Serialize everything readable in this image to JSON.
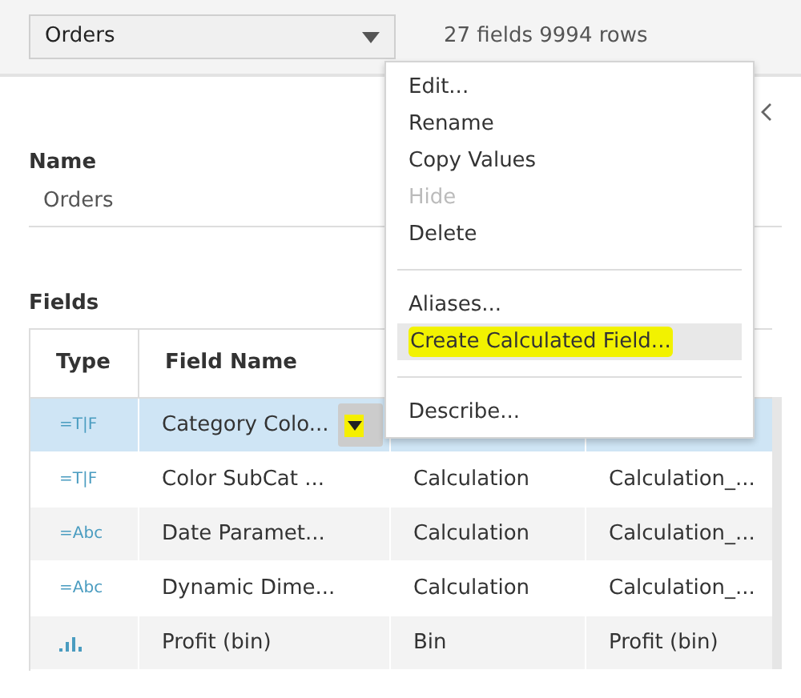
{
  "source_select": {
    "value": "Orders"
  },
  "summary": "27 fields 9994 rows",
  "name_section": {
    "label": "Name",
    "value": "Orders"
  },
  "fields_section": {
    "label": "Fields",
    "columns": [
      "Type",
      "Field Name"
    ],
    "rows": [
      {
        "kind": "boolean",
        "type_icon": "=T|F",
        "name": "Category Colo...",
        "selected": true
      },
      {
        "kind": "boolean",
        "type_icon": "=T|F",
        "name": "Color SubCat ...",
        "selected": false,
        "column_3": "Calculation",
        "column_4": "Calculation_..."
      },
      {
        "kind": "string",
        "type_icon": "=Abc",
        "name": "Date Paramet...",
        "selected": false,
        "column_3": "Calculation",
        "column_4": "Calculation_..."
      },
      {
        "kind": "string",
        "type_icon": "=Abc",
        "name": "Dynamic Dime...",
        "selected": false,
        "column_3": "Calculation",
        "column_4": "Calculation_..."
      },
      {
        "kind": "bin",
        "name": "Profit (bin)",
        "selected": false,
        "column_3": "Bin",
        "column_4": "Profit (bin)"
      }
    ]
  },
  "context_menu": {
    "groups": [
      [
        {
          "label": "Edit...",
          "disabled": false,
          "highlighted": false
        },
        {
          "label": "Rename",
          "disabled": false,
          "highlighted": false
        },
        {
          "label": "Copy Values",
          "disabled": false,
          "highlighted": false
        },
        {
          "label": "Hide",
          "disabled": true,
          "highlighted": false
        },
        {
          "label": "Delete",
          "disabled": false,
          "highlighted": false
        }
      ],
      [
        {
          "label": "Aliases...",
          "disabled": false,
          "highlighted": false
        },
        {
          "label": "Create Calculated Field...",
          "disabled": false,
          "highlighted": true
        }
      ],
      [
        {
          "label": "Describe...",
          "disabled": false,
          "highlighted": false
        }
      ]
    ]
  }
}
